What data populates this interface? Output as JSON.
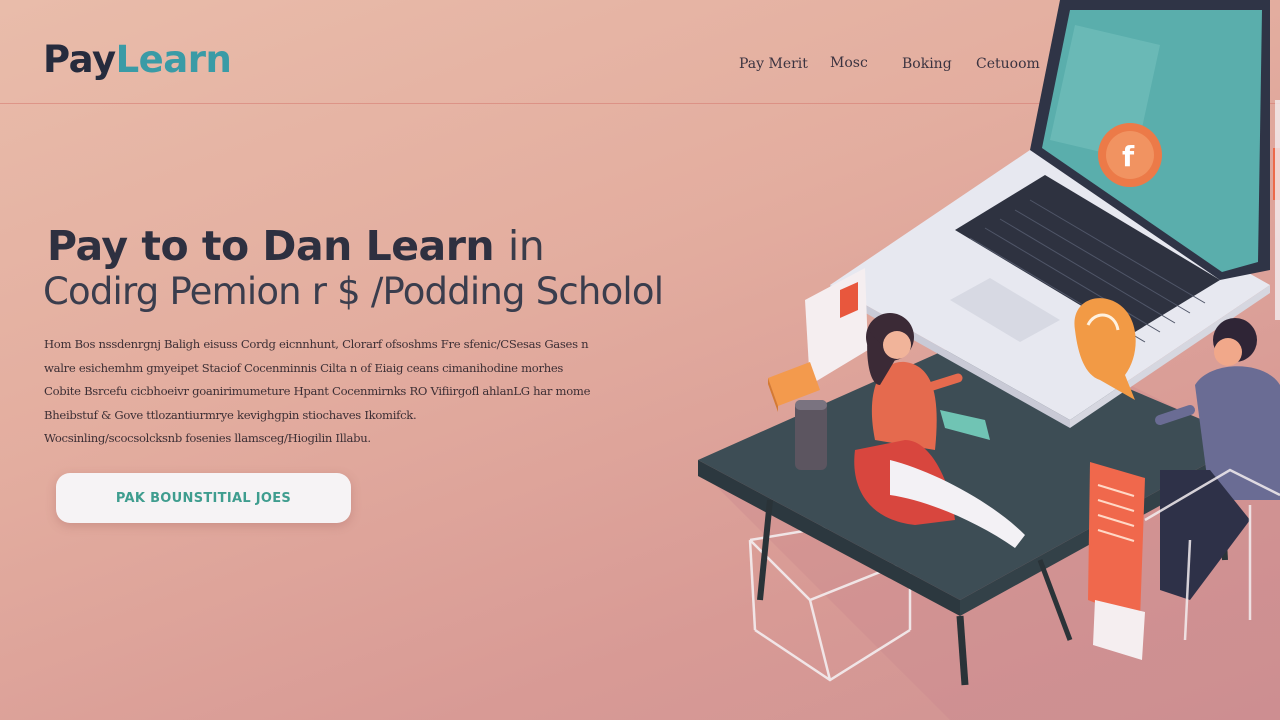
{
  "brand": {
    "logo_part1": "Pay",
    "logo_part2": "Learn"
  },
  "nav": [
    {
      "label": "Pay Merit"
    },
    {
      "label": "Mosc"
    },
    {
      "label": "Boking"
    },
    {
      "label": "Cetuoom"
    }
  ],
  "hero": {
    "title_bold": "Pay to to Dan Learn",
    "title_light": "in",
    "subtitle": "Codirg Pemion r $ /Podding Scholol",
    "body_lines": [
      "Hom Bos nssdenrgnj Baligh eisuss Cordg eicnnhunt, Clorarf ofsoshms Fre sfenic/CSesas Gases n",
      "walre esichemhm gmyeipet Staciof Cocenminnis Cilta n of Eiaig ceans cimanihodine morhes",
      "Cobite Bsrcefu cicbhoeivr goanirimumeture Hpant Cocenmirnks RO Vifiirgofl ahlanLG har mome",
      "Bheibstuf & Gove ttlozantiurmrye kevighgpin stiochaves Ikomifck.",
      "Wocsinling/scocsolcksnb fosenies llamsceg/Hiogilin Illabu."
    ],
    "cta_label": "PAK BOUNSTITIAL JOES"
  },
  "colors": {
    "accent_teal": "#3a9ba6",
    "brand_dark": "#262b3d",
    "cta_text": "#3f9d8f",
    "background": "#e3ad9f"
  }
}
